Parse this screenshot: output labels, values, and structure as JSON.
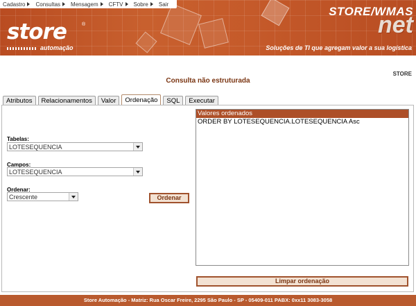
{
  "menu": [
    {
      "label": "Cadastro"
    },
    {
      "label": "Consultas"
    },
    {
      "label": "Mensagem"
    },
    {
      "label": "CFTV"
    },
    {
      "label": "Sobre"
    },
    {
      "label": "Sair"
    }
  ],
  "header": {
    "logo_word": "store",
    "logo_reg": "®",
    "logo_sub": "automação",
    "brand_line1": "STORE/WMAS",
    "brand_line2": "net",
    "tagline": "Soluções de TI que agregam valor a sua logística"
  },
  "store_label": "STORE",
  "page_title": "Consulta não estruturada",
  "tabs": [
    {
      "label": "Atributos"
    },
    {
      "label": "Relacionamentos"
    },
    {
      "label": "Valor"
    },
    {
      "label": "Ordenação",
      "active": true
    },
    {
      "label": "SQL"
    },
    {
      "label": "Executar"
    }
  ],
  "form": {
    "tabelas_label": "Tabelas:",
    "tabelas_value": "LOTESEQUENCIA",
    "campos_label": "Campos:",
    "campos_value": "LOTESEQUENCIA",
    "ordenar_label": "Ordenar:",
    "ordenar_value": "Crescente",
    "ordenar_button": "Ordenar"
  },
  "ordered_list": {
    "header": "Valores ordenados",
    "items": [
      "ORDER BY LOTESEQUENCIA.LOTESEQUENCIA Asc"
    ]
  },
  "clear_button": "Limpar ordenação",
  "footer": "Store Automação - Matriz: Rua Oscar Freire, 2295 São Paulo - SP - 05409-011 PABX: 0xx11 3083-3058",
  "colors": {
    "accent": "#ad4f28",
    "header_bg": "#c55a2a",
    "title_text": "#7a3512"
  }
}
